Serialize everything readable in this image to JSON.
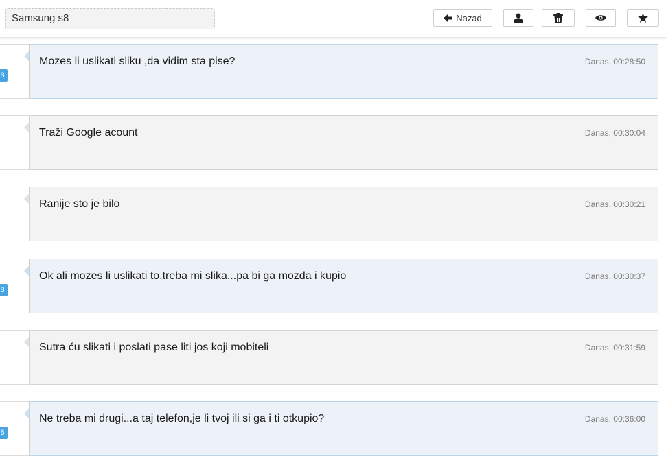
{
  "header": {
    "subject": "Samsung s8",
    "back_label": "Nazad",
    "buttons": {
      "back_icon": "arrow-left-icon",
      "user_icon": "user-icon",
      "delete_icon": "trash-icon",
      "view_icon": "eye-icon",
      "favorite_icon": "star-icon"
    }
  },
  "messages": [
    {
      "text": "Mozes li uslikati sliku ,da vidim sta pise?",
      "time": "Danas, 00:28:50",
      "mine": true,
      "badge": "8"
    },
    {
      "text": "Traži Google acount",
      "time": "Danas, 00:30:04",
      "mine": false
    },
    {
      "text": "Ranije sto je bilo",
      "time": "Danas, 00:30:21",
      "mine": false
    },
    {
      "text": "Ok ali mozes li uslikati to,treba mi slika...pa bi ga mozda i kupio",
      "time": "Danas, 00:30:37",
      "mine": true,
      "badge": "8"
    },
    {
      "text": "Sutra ću slikati i poslati pase liti jos koji mobiteli",
      "time": "Danas, 00:31:59",
      "mine": false
    },
    {
      "text": "Ne treba mi drugi...a taj telefon,je li tvoj ili si ga i ti otkupio?",
      "time": "Danas, 00:36:00",
      "mine": true,
      "badge": "8"
    }
  ],
  "colors": {
    "mine_bg": "#edf2f9",
    "mine_border": "#b8d5ea",
    "other_bg": "#f3f3f3",
    "badge": "#4aa3dc"
  }
}
